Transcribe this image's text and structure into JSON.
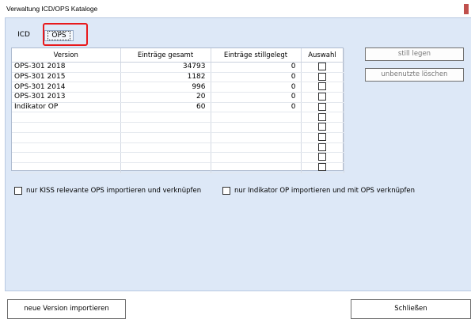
{
  "window": {
    "title": "Verwaltung ICD/OPS Kataloge"
  },
  "tabs": [
    {
      "label": "ICD",
      "selected": false
    },
    {
      "label": "OPS",
      "selected": true
    }
  ],
  "grid": {
    "columns": [
      "Version",
      "Einträge gesamt",
      "Einträge stillgelegt",
      "Auswahl"
    ],
    "rows": [
      {
        "version": "OPS-301 2018",
        "total": "34793",
        "retired": "0",
        "checked": false
      },
      {
        "version": "OPS-301 2015",
        "total": "1182",
        "retired": "0",
        "checked": false
      },
      {
        "version": "OPS-301 2014",
        "total": "996",
        "retired": "0",
        "checked": false
      },
      {
        "version": "OPS-301 2013",
        "total": "20",
        "retired": "0",
        "checked": false
      },
      {
        "version": "Indikator OP",
        "total": "60",
        "retired": "0",
        "checked": false
      }
    ],
    "empty_rows": 6
  },
  "side_buttons": {
    "retire": "still legen",
    "delete_unused": "unbenutzte löschen"
  },
  "options": {
    "kiss_only": "nur KISS relevante OPS importieren und verknüpfen",
    "indicator_only": "nur Indikator OP importieren und mit OPS verknüpfen"
  },
  "footer": {
    "import_button": "neue Version importieren",
    "close_button": "Schließen"
  },
  "colors": {
    "client_bg": "#dde8f7",
    "highlight": "#e8191c"
  }
}
